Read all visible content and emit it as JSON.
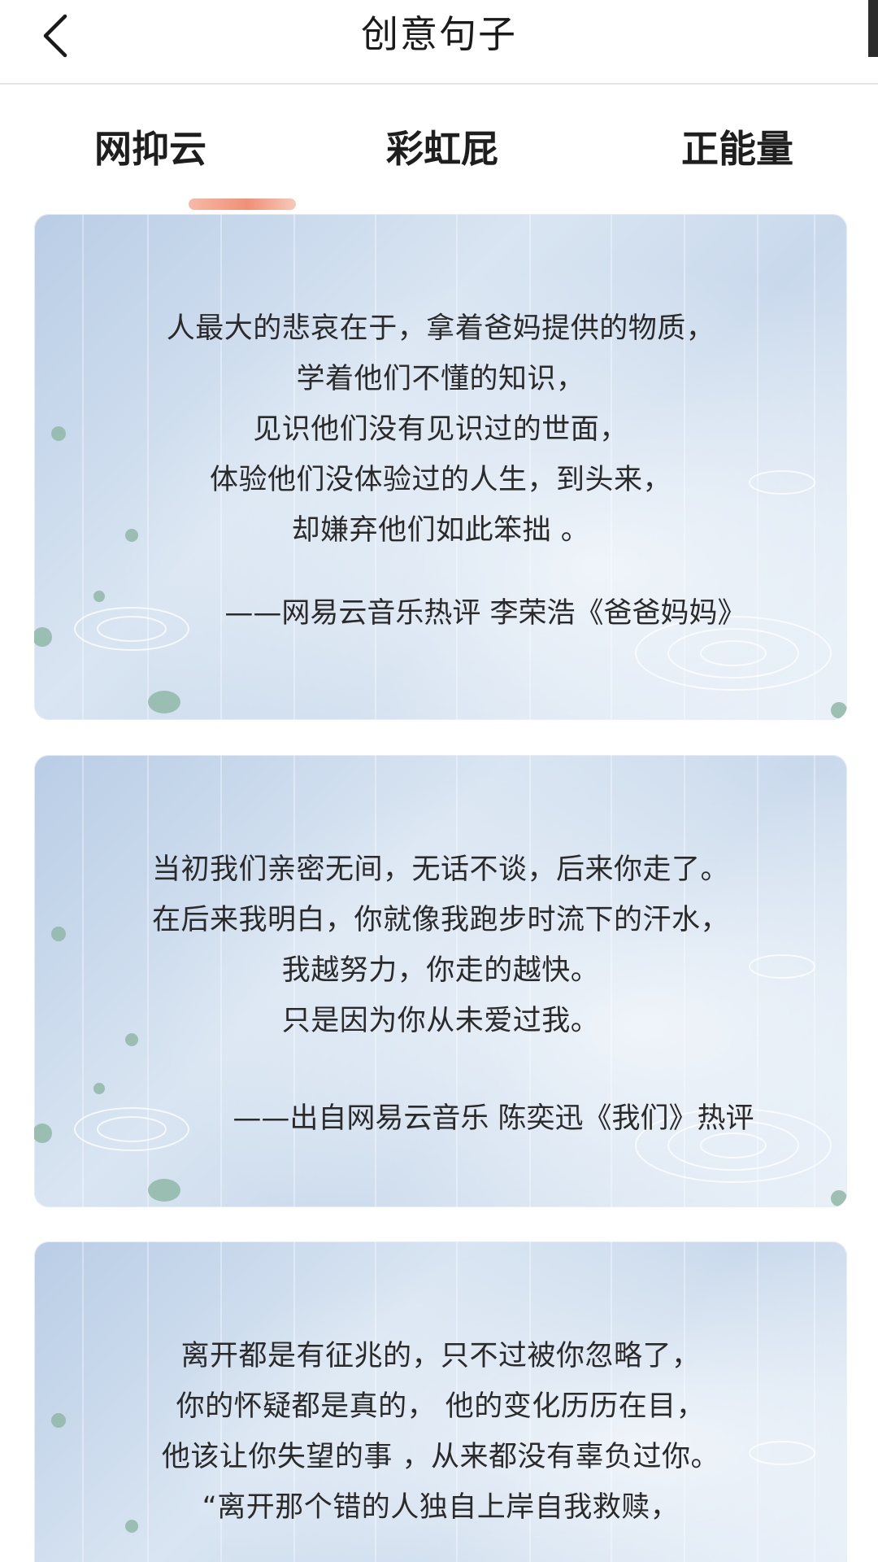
{
  "header": {
    "title": "创意句子",
    "back_icon": "chevron-left-icon"
  },
  "tabs": [
    {
      "label": "网抑云",
      "active": true
    },
    {
      "label": "彩虹屁",
      "active": false
    },
    {
      "label": "正能量",
      "active": false
    }
  ],
  "colors": {
    "accent_underline": "#f08a70",
    "card_blue": "#c9d9ec"
  },
  "cards": [
    {
      "lines": [
        "人最大的悲哀在于，拿着爸妈提供的物质，",
        "学着他们不懂的知识，",
        "见识他们没有见识过的世面，",
        "体验他们没体验过的人生，到头来，",
        "却嫌弃他们如此笨拙 。"
      ],
      "source": "——网易云音乐热评 李荣浩《爸爸妈妈》"
    },
    {
      "lines": [
        "当初我们亲密无间，无话不谈，后来你走了。",
        "在后来我明白，你就像我跑步时流下的汗水，",
        "我越努力，你走的越快。",
        "只是因为你从未爱过我。"
      ],
      "source": "——出自网易云音乐 陈奕迅《我们》热评"
    },
    {
      "lines": [
        "离开都是有征兆的，只不过被你忽略了，",
        "你的怀疑都是真的， 他的变化历历在目，",
        "他该让你失望的事 ，从来都没有辜负过你。",
        "“离开那个错的人独自上岸自我救赎，"
      ]
    }
  ]
}
